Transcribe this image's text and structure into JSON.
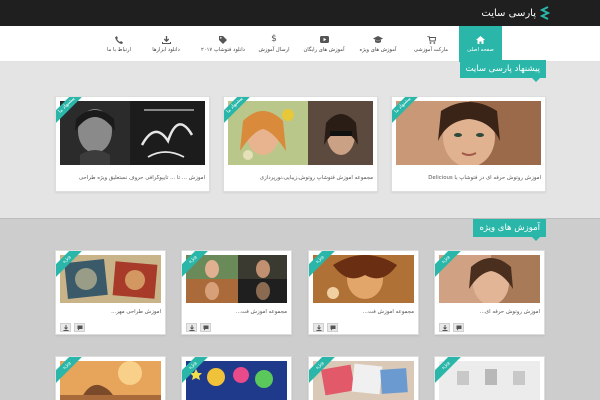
{
  "brand": {
    "name": "پارسی سایت",
    "accent": "#2ab7a9"
  },
  "nav": {
    "items": [
      {
        "label": "صفحه اصلی",
        "icon": "home-icon"
      },
      {
        "label": "مارکت آموزشی",
        "icon": "cart-icon"
      },
      {
        "label": "آموزش های ویژه",
        "icon": "graduation-cap-icon"
      },
      {
        "label": "آموزش های رایگان",
        "icon": "video-icon"
      },
      {
        "label": "ارسال آموزش",
        "icon": "dollar-icon"
      },
      {
        "label": "دانلود فتوشاپ ۲۰۱۷",
        "icon": "tags-icon"
      },
      {
        "label": "دانلود ابزارها",
        "icon": "download-icon"
      },
      {
        "label": "ارتباط با ما",
        "icon": "phone-icon"
      }
    ]
  },
  "suggestion": {
    "title": "پیشنهاد پارسی سایت",
    "badge": "پیشنهاد ما",
    "cards": [
      {
        "caption": "آموزش روتوش حرفه ای در فتوشاپ با Delicious"
      },
      {
        "caption": "مجموعه آموزش فتوشاپ روتوش،زیبایی،نورپردازی"
      },
      {
        "caption": "آموزش ... تا ... تایپوگرافی حروف نستعلیق ویژه طراحی"
      }
    ]
  },
  "special": {
    "title": "آموزش های ویژه",
    "badge": "ویژه",
    "cards": [
      {
        "caption": "آموزش روتوش حرفه ای..."
      },
      {
        "caption": "مجموعه آموزش فت..."
      },
      {
        "caption": "مجموعه آموزش فت..."
      },
      {
        "caption": "آموزش طراحی مهر..."
      }
    ]
  }
}
